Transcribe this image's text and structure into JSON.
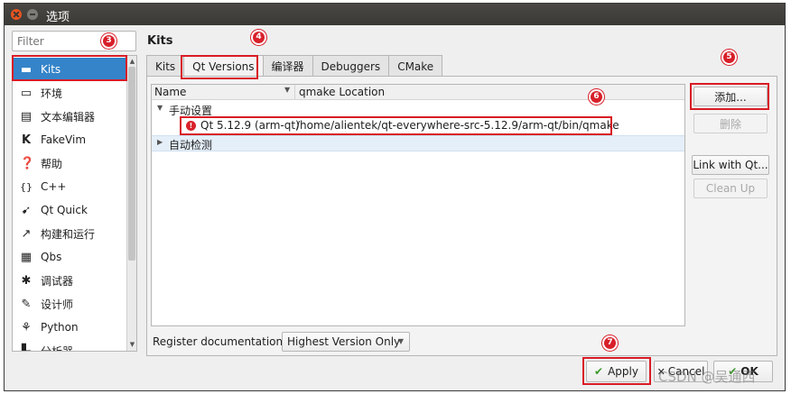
{
  "window": {
    "title": "选项"
  },
  "filter": {
    "placeholder": "Filter"
  },
  "sidebar": {
    "items": [
      {
        "label": "Kits",
        "icon": "kits-icon"
      },
      {
        "label": "环境",
        "icon": "monitor-icon"
      },
      {
        "label": "文本编辑器",
        "icon": "text-editor-icon"
      },
      {
        "label": "FakeVim",
        "icon": "fakevim-icon"
      },
      {
        "label": "帮助",
        "icon": "help-icon"
      },
      {
        "label": "C++",
        "icon": "braces-icon"
      },
      {
        "label": "Qt Quick",
        "icon": "qt-quick-icon"
      },
      {
        "label": "构建和运行",
        "icon": "build-run-icon"
      },
      {
        "label": "Qbs",
        "icon": "qbs-icon"
      },
      {
        "label": "调试器",
        "icon": "debugger-icon"
      },
      {
        "label": "设计师",
        "icon": "designer-icon"
      },
      {
        "label": "Python",
        "icon": "python-icon"
      },
      {
        "label": "分析器",
        "icon": "analyzer-icon"
      }
    ],
    "selected": "Kits"
  },
  "page": {
    "title": "Kits"
  },
  "tabs": [
    "Kits",
    "Qt Versions",
    "编译器",
    "Debuggers",
    "CMake"
  ],
  "active_tab": "Qt Versions",
  "tree": {
    "columns": [
      "Name",
      "qmake Location"
    ],
    "manual_group": "手动设置",
    "qt_entry": {
      "name": "Qt 5.12.9 (arm-qt)",
      "path": "/home/alientek/qt-everywhere-src-5.12.9/arm-qt/bin/qmake",
      "status_icon": "error-icon"
    },
    "auto_group": "自动检测"
  },
  "buttons": {
    "add": "添加...",
    "remove": "删除",
    "link": "Link with Qt...",
    "cleanup": "Clean Up"
  },
  "register_doc": {
    "label": "Register documentation:",
    "value": "Highest Version Only"
  },
  "dialog_buttons": {
    "apply": "Apply",
    "cancel": "Cancel",
    "ok": "OK"
  },
  "annotations": [
    "3",
    "4",
    "5",
    "6",
    "7"
  ],
  "watermark": "CSDN @吴通西",
  "colors": {
    "selection": "#3584c9",
    "annotation_red": "#d81c26",
    "title_bar": "#3a3935"
  }
}
